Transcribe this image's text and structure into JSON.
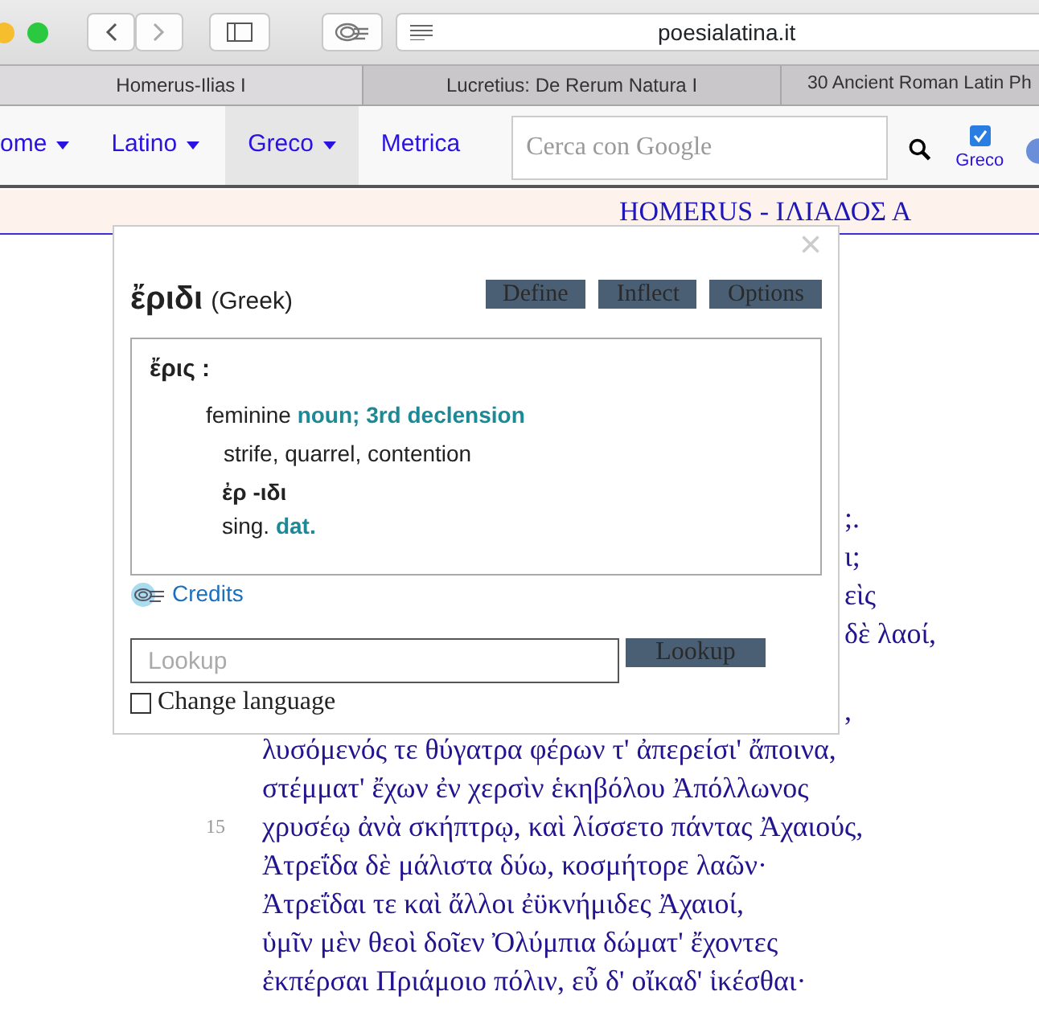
{
  "browser": {
    "address": "poesialatina.it",
    "tabs": [
      {
        "label": "Homerus-Ilias I",
        "selected": true
      },
      {
        "label": "Lucretius: De Rerum Natura I",
        "selected": false
      },
      {
        "label": "30 Ancient Roman Latin Ph",
        "selected": false
      }
    ]
  },
  "nav": {
    "items": [
      {
        "label": "ome",
        "dropdown": true,
        "selected": false
      },
      {
        "label": "Latino",
        "dropdown": true,
        "selected": false
      },
      {
        "label": "Greco",
        "dropdown": true,
        "selected": true
      },
      {
        "label": "Metrica",
        "dropdown": false,
        "selected": false
      }
    ],
    "search": {
      "placeholder": "Cerca con Google"
    },
    "greek_toggle": {
      "label": "Greco",
      "checked": true
    }
  },
  "header": {
    "title": "HOMERUS - ΙΛΙΑΔΟΣ Α"
  },
  "poem": [
    {
      "kind": "fragment",
      "text": ";."
    },
    {
      "kind": "fragment",
      "text": "ι;"
    },
    {
      "kind": "fragment",
      "text": "εὶς"
    },
    {
      "kind": "fragment",
      "text": "δὲ λαοί,"
    },
    {
      "kind": "gap"
    },
    {
      "kind": "fragment",
      "text": ","
    },
    {
      "kind": "line",
      "text": "λυσόμενός τε θύγατρα φέρων τ' ἀπερείσι' ἄποινα,"
    },
    {
      "kind": "line",
      "text": "στέμματ' ἔχων ἐν χερσὶν ἑκηβόλου Ἀπόλλωνος"
    },
    {
      "kind": "line",
      "number": "15",
      "text": "χρυσέῳ ἀνὰ σκήπτρῳ, καὶ λίσσετο πάντας Ἀχαιούς,"
    },
    {
      "kind": "line",
      "text": "Ἀτρεΐδα δὲ μάλιστα δύω, κοσμήτορε λαῶν·"
    },
    {
      "kind": "line",
      "text": "Ἀτρεΐδαι τε καὶ ἄλλοι ἐϋκνήμιδες Ἀχαιοί,"
    },
    {
      "kind": "line",
      "text": "ὑμῖν μὲν θεοὶ δοῖεν Ὀλύμπια δώματ' ἔχοντες"
    },
    {
      "kind": "line",
      "text": "ἐκπέρσαι Πριάμοιο πόλιν, εὖ δ' οἴκαδ' ἱκέσθαι·"
    }
  ],
  "popup": {
    "close": "×",
    "word": "ἔριδι",
    "language": "(Greek)",
    "buttons": [
      "Define",
      "Inflect",
      "Options"
    ],
    "definition": [
      {
        "kind": "lemma",
        "text": "ἔρις :"
      },
      {
        "kind": "pos",
        "text": "feminine **noun; 3rd declension**"
      },
      {
        "kind": "meaning",
        "text": "strife, quarrel, contention"
      },
      {
        "kind": "form",
        "text": "ἐρ -ιδι"
      },
      {
        "kind": "parse",
        "text": "sing. **dat.**"
      }
    ],
    "credits": "Credits",
    "lookup": {
      "placeholder": "Lookup",
      "button": "Lookup"
    },
    "change_language": {
      "label": "Change language",
      "checked": false
    }
  }
}
